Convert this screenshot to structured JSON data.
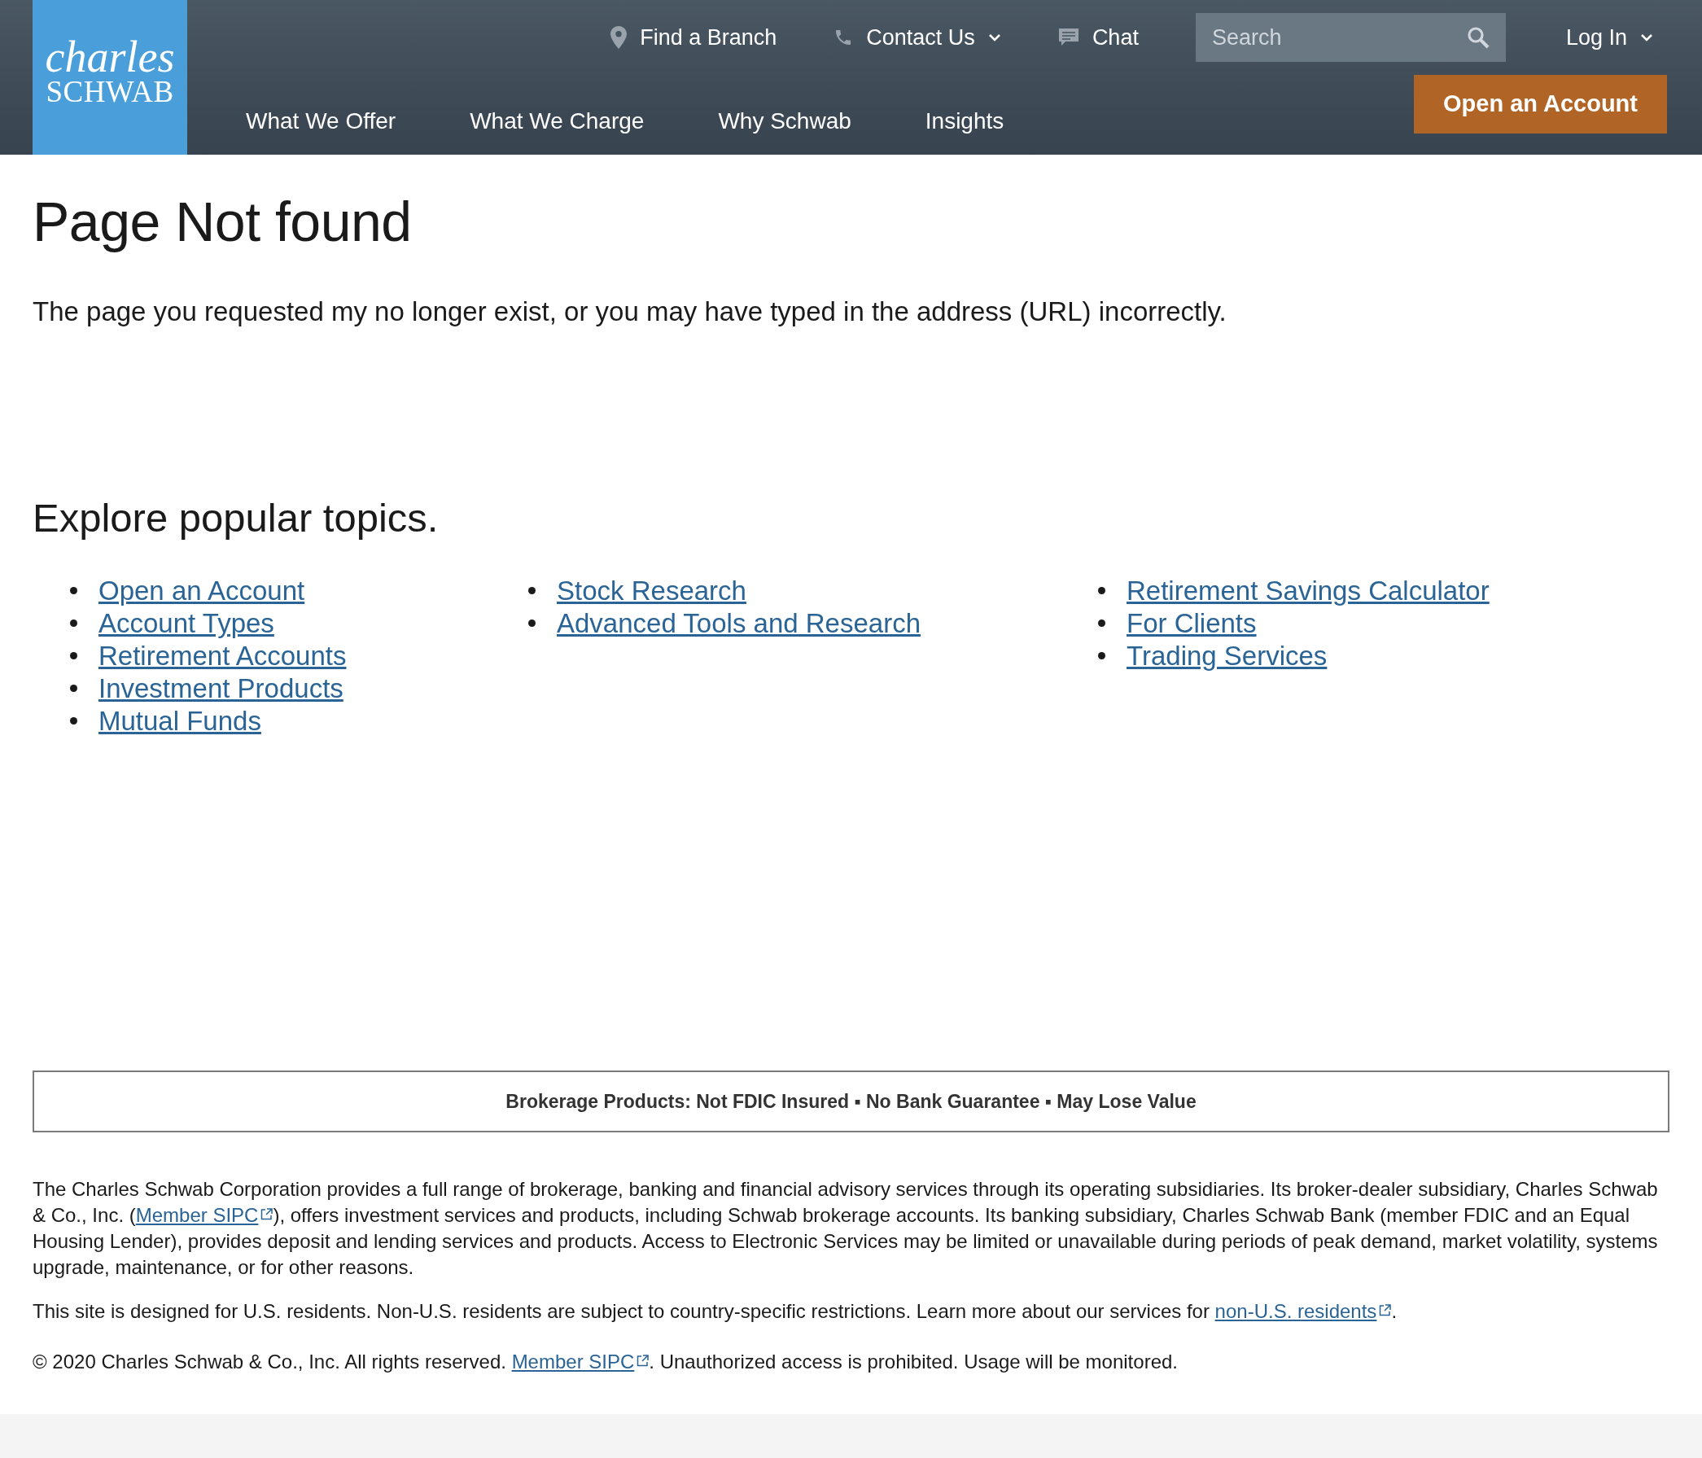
{
  "logo": {
    "line1": "charles",
    "line2": "SCHWAB"
  },
  "utility_nav": [
    {
      "kind": "pin",
      "label": "Find a Branch"
    },
    {
      "kind": "phone",
      "label": "Contact Us",
      "dropdown": true
    },
    {
      "kind": "chat",
      "label": "Chat"
    }
  ],
  "search": {
    "placeholder": "Search"
  },
  "login": {
    "label": "Log In"
  },
  "main_nav": [
    "What We Offer",
    "What We Charge",
    "Why Schwab",
    "Insights"
  ],
  "cta": "Open an Account",
  "title": "Page Not found",
  "message": "The page you requested my no longer exist, or you may have typed in the address (URL) incorrectly.",
  "topics_heading": "Explore popular topics.",
  "topic_columns": [
    [
      "Open an Account",
      "Account Types",
      "Retirement Accounts",
      "Investment Products",
      "Mutual Funds"
    ],
    [
      "Stock Research",
      "Advanced Tools and Research"
    ],
    [
      "Retirement Savings Calculator",
      "For Clients",
      "Trading Services"
    ]
  ],
  "disclosure": "Brokerage Products: Not FDIC Insured ▪ No Bank Guarantee ▪ May Lose Value",
  "footer_paragraphs": [
    [
      {
        "text": "The Charles Schwab Corporation provides a full range of brokerage, banking and financial advisory services through its operating subsidiaries. Its broker-dealer subsidiary, Charles Schwab & Co., Inc. ("
      },
      {
        "link": "Member SIPC"
      },
      {
        "text": "), offers investment services and products, including Schwab brokerage accounts. Its banking subsidiary, Charles Schwab Bank (member FDIC and an Equal Housing Lender), provides deposit and lending services and products. Access to Electronic Services may be limited or unavailable during periods of peak demand, market volatility, systems upgrade, maintenance, or for other reasons."
      }
    ],
    [
      {
        "text": "This site is designed for U.S. residents. Non-U.S. residents are subject to country-specific restrictions. Learn more about our services for "
      },
      {
        "link": "non-U.S. residents"
      },
      {
        "text": "."
      }
    ],
    [
      {
        "text": "© 2020 Charles Schwab & Co., Inc. All rights reserved. "
      },
      {
        "link": "Member SIPC"
      },
      {
        "text": ". Unauthorized access is prohibited. Usage will be monitored."
      }
    ]
  ]
}
